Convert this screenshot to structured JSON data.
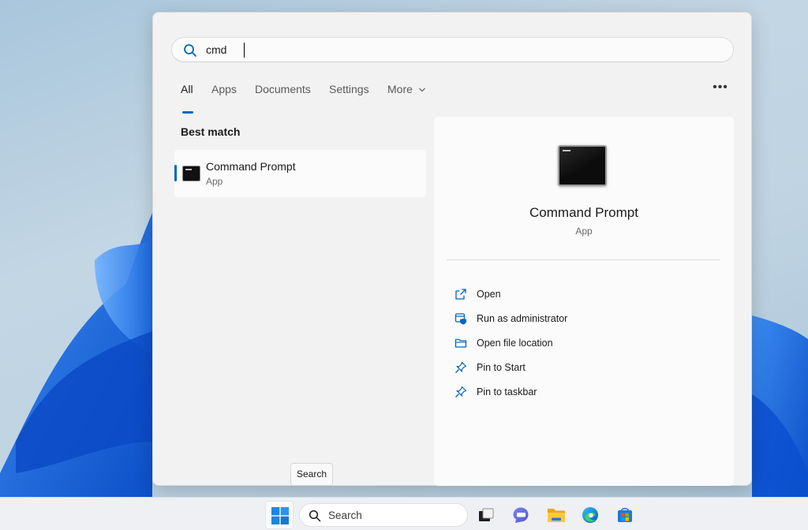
{
  "search": {
    "query": "cmd"
  },
  "tabs": [
    {
      "label": "All",
      "active": true
    },
    {
      "label": "Apps"
    },
    {
      "label": "Documents"
    },
    {
      "label": "Settings"
    },
    {
      "label": "More"
    }
  ],
  "more_options_icon": "ellipsis-icon",
  "best_match": {
    "heading": "Best match",
    "result": {
      "name": "Command Prompt",
      "type": "App",
      "icon": "command-prompt-icon"
    }
  },
  "detail": {
    "title": "Command Prompt",
    "subtitle": "App",
    "actions": [
      {
        "label": "Open",
        "icon": "open-external-icon"
      },
      {
        "label": "Run as administrator",
        "icon": "shield-admin-icon"
      },
      {
        "label": "Open file location",
        "icon": "folder-icon"
      },
      {
        "label": "Pin to Start",
        "icon": "pin-icon"
      },
      {
        "label": "Pin to taskbar",
        "icon": "pin-icon"
      }
    ]
  },
  "tooltip": "Search",
  "taskbar": {
    "search_label": "Search",
    "apps": [
      "start-icon",
      "task-view-icon",
      "teams-chat-icon",
      "file-explorer-icon",
      "edge-icon",
      "store-icon"
    ]
  },
  "colors": {
    "accent": "#0067c0",
    "wallpaper_blue": "#1a6fe6"
  }
}
